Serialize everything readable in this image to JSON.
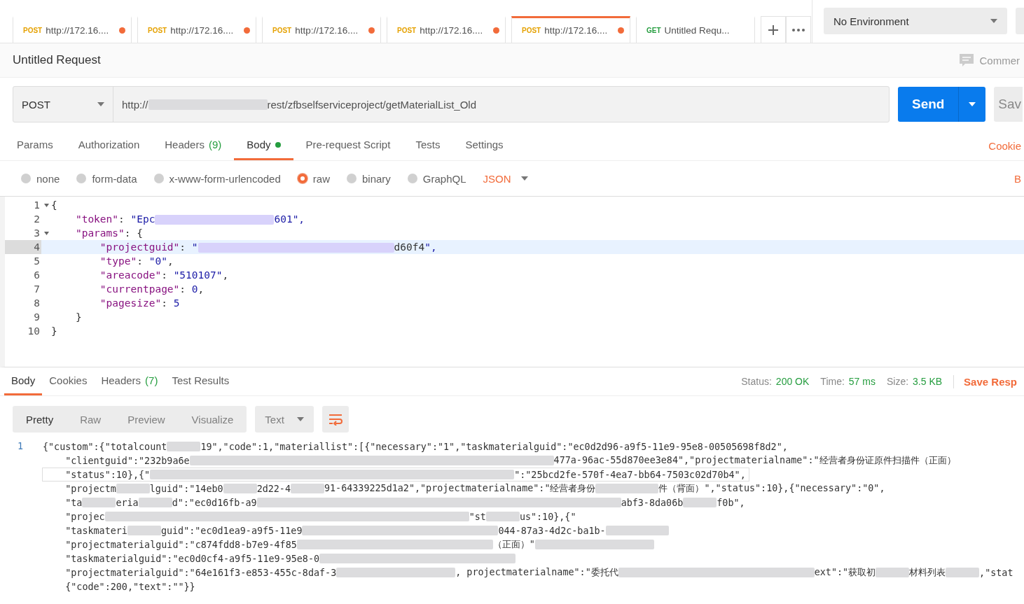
{
  "tabs": [
    {
      "method": "POST",
      "color": "#e5a100",
      "title": "http://172.16....",
      "unsaved": true,
      "selected": false
    },
    {
      "method": "POST",
      "color": "#e5a100",
      "title": "http://172.16....",
      "unsaved": true,
      "selected": false
    },
    {
      "method": "POST",
      "color": "#e5a100",
      "title": "http://172.16....",
      "unsaved": true,
      "selected": false
    },
    {
      "method": "POST",
      "color": "#e5a100",
      "title": "http://172.16....",
      "unsaved": true,
      "selected": false
    },
    {
      "method": "POST",
      "color": "#e5a100",
      "title": "http://172.16....",
      "unsaved": true,
      "selected": true
    },
    {
      "method": "GET",
      "color": "#259d3f",
      "title": "Untitled Requ...",
      "unsaved": false,
      "selected": false
    }
  ],
  "environment": "No Environment",
  "request_name": "Untitled Request",
  "comments_button": "Commer",
  "method": "POST",
  "url": [
    {
      "text": "http://"
    },
    {
      "kind": "patch"
    },
    {
      "text": "rest/zfbselfserviceproject/getMaterialList_Old"
    }
  ],
  "send_button": "Send",
  "save_button": "Sav",
  "request_tabs": [
    {
      "label": "Params",
      "selected": false
    },
    {
      "label": "Authorization",
      "selected": false
    },
    {
      "label": "Headers",
      "count": "(9)",
      "selected": false
    },
    {
      "label": "Body",
      "dot": true,
      "selected": true
    },
    {
      "label": "Pre-request Script",
      "selected": false
    },
    {
      "label": "Tests",
      "selected": false
    },
    {
      "label": "Settings",
      "selected": false
    }
  ],
  "cookies_link": "Cookie",
  "body_types": [
    {
      "label": "none",
      "selected": false
    },
    {
      "label": "form-data",
      "selected": false
    },
    {
      "label": "x-www-form-urlencoded",
      "selected": false
    },
    {
      "label": "raw",
      "selected": true
    },
    {
      "label": "binary",
      "selected": false
    },
    {
      "label": "GraphQL",
      "selected": false
    }
  ],
  "format": "JSON",
  "beautify_link": "B",
  "editor_lines": [
    {
      "number": "1",
      "fold": true,
      "active": false,
      "segments": [
        {
          "text": "{"
        }
      ]
    },
    {
      "number": "2",
      "fold": false,
      "active": false,
      "segments": [
        {
          "text": "    \"token\": \"Epc"
        },
        {
          "kind": "patch"
        },
        {
          "text": "601\","
        }
      ]
    },
    {
      "number": "3",
      "fold": true,
      "active": false,
      "segments": [
        {
          "text": "    \"params\": {"
        }
      ]
    },
    {
      "number": "4",
      "fold": false,
      "active": true,
      "segments": [
        {
          "text": "        \"projectguid\": \""
        },
        {
          "kind": "band"
        },
        {
          "text": "d60f4\","
        }
      ]
    },
    {
      "number": "5",
      "fold": false,
      "active": false,
      "segments": [
        {
          "text": "        \"type\": \"0\","
        }
      ]
    },
    {
      "number": "6",
      "fold": false,
      "active": false,
      "segments": [
        {
          "text": "        \"areacode\": \"510107\","
        }
      ]
    },
    {
      "number": "7",
      "fold": false,
      "active": false,
      "segments": [
        {
          "text": "        \"currentpage\": 0,"
        }
      ]
    },
    {
      "number": "8",
      "fold": false,
      "active": false,
      "segments": [
        {
          "text": "        \"pagesize\": 5"
        }
      ]
    },
    {
      "number": "9",
      "fold": false,
      "active": false,
      "segments": [
        {
          "text": "    }"
        }
      ]
    },
    {
      "number": "10",
      "fold": false,
      "active": false,
      "segments": [
        {
          "text": "}"
        }
      ]
    }
  ],
  "response_tabs": [
    {
      "label": "Body",
      "selected": true
    },
    {
      "label": "Cookies",
      "selected": false
    },
    {
      "label": "Headers",
      "count": "(7)",
      "selected": false
    },
    {
      "label": "Test Results",
      "selected": false
    }
  ],
  "status": {
    "label": "Status:",
    "value": "200 OK"
  },
  "time": {
    "label": "Time:",
    "value": "57 ms"
  },
  "size": {
    "label": "Size:",
    "value": "3.5 KB"
  },
  "save_response": "Save Resp",
  "view_modes": [
    {
      "label": "Pretty",
      "selected": true
    },
    {
      "label": "Raw",
      "selected": false
    },
    {
      "label": "Preview",
      "selected": false
    },
    {
      "label": "Visualize",
      "selected": false
    }
  ],
  "response_format": "Text",
  "response_lines": [
    {
      "number": "1",
      "active": false,
      "segments": [
        {
          "text": "{\"custom\":{\"totalcount"
        },
        {
          "kind": "gap"
        },
        {
          "text": "19\",\"code\":1,\"materiallist\":[{\"necessary\":\"1\",\"taskmaterialguid\":\"ec0d2d96-a9f5-11e9-95e8-00505698f8d2\","
        }
      ]
    },
    {
      "active": false,
      "segments": [
        {
          "text": "    \"clientguid\":\"232b9a6e"
        },
        {
          "kind": "swath"
        },
        {
          "text": "477a-96ac-55d870ee3e84\",\"projectmaterialname\":\"经营者身份证原件扫描件（正面）"
        }
      ]
    },
    {
      "active": true,
      "segments": [
        {
          "text": "    \"status\":10},{\""
        },
        {
          "kind": "swath"
        },
        {
          "text": "\":\"25bcd2fe-570f-4ea7-bb64-7503c02d70b4\","
        }
      ]
    },
    {
      "active": false,
      "segments": [
        {
          "text": "    \"projectm"
        },
        {
          "kind": "gap"
        },
        {
          "text": "lguid\":\"14eb0"
        },
        {
          "kind": "gap"
        },
        {
          "text": "2d22-4"
        },
        {
          "kind": "gap"
        },
        {
          "text": "91-64339225d1a2\",\"projectmaterialname\":\"经营者身份"
        },
        {
          "kind": "blur"
        },
        {
          "text": "件（背面）\",\"status\":10},{\"necessary\":\"0\","
        }
      ]
    },
    {
      "active": false,
      "segments": [
        {
          "text": "    \"ta"
        },
        {
          "kind": "gap"
        },
        {
          "text": "eria"
        },
        {
          "kind": "gap"
        },
        {
          "text": "d\":\"ec0d16fb-a9"
        },
        {
          "kind": "swath"
        },
        {
          "text": "abf3-8da06b"
        },
        {
          "kind": "gap"
        },
        {
          "text": "f0b\","
        }
      ]
    },
    {
      "active": false,
      "segments": [
        {
          "text": "    \"projec"
        },
        {
          "kind": "swath"
        },
        {
          "text": "\"st"
        },
        {
          "kind": "gap"
        },
        {
          "text": "us\":10},{\""
        }
      ]
    },
    {
      "active": false,
      "segments": [
        {
          "text": "    \"taskmateri"
        },
        {
          "kind": "gap"
        },
        {
          "text": "guid\":\"ec0d1ea9-a9f5-11e9"
        },
        {
          "kind": "band"
        },
        {
          "text": "044-87a3-4d2c-ba1b-"
        },
        {
          "kind": "blur"
        }
      ]
    },
    {
      "active": false,
      "segments": [
        {
          "text": "    \"projectmaterialguid\":\"c874fdd8-b7e9-4f85"
        },
        {
          "kind": "band"
        },
        {
          "text": "（正面）\""
        },
        {
          "kind": "patch"
        }
      ]
    },
    {
      "active": false,
      "segments": [
        {
          "text": "    \"taskmaterialguid\":\"ec0d0cf4-a9f5-11e9-95e8-0"
        },
        {
          "kind": "band"
        }
      ]
    },
    {
      "active": false,
      "segments": [
        {
          "text": "    \"projectmaterialguid\":\"64e161f3-e853-455c-8daf-3"
        },
        {
          "kind": "patch"
        },
        {
          "text": ", projectmaterialname\":\"委托代"
        },
        {
          "kind": "band"
        },
        {
          "text": "ext\":\"获取初"
        },
        {
          "kind": "gap"
        },
        {
          "text": "材料列表"
        },
        {
          "kind": "gap"
        },
        {
          "text": ",\"stat"
        }
      ]
    },
    {
      "active": false,
      "segments": [
        {
          "text": "    {\"code\":200,\"text\":\"\"}}"
        }
      ]
    }
  ]
}
